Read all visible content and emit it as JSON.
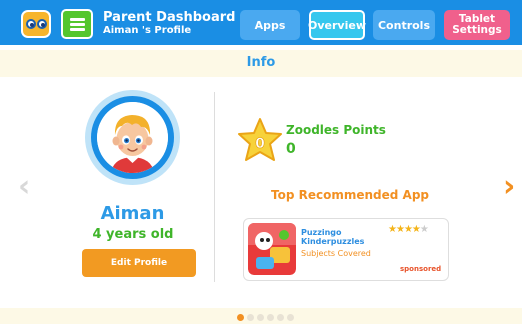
{
  "header": {
    "title": "Parent Dashboard",
    "subtitle": "Aiman 's Profile",
    "tabs": [
      {
        "label": "Apps"
      },
      {
        "label": "Overview"
      },
      {
        "label": "Controls"
      },
      {
        "label": "Tablet Settings"
      }
    ],
    "active_tab": "Overview"
  },
  "section": {
    "title": "Info"
  },
  "profile": {
    "name": "Aiman",
    "age": "4 years old",
    "edit_label": "Edit Profile"
  },
  "points": {
    "label": "Zoodles Points",
    "value": "0",
    "star_digit": "0"
  },
  "recommended": {
    "title": "Top Recommended App",
    "app": {
      "name_line1": "Puzzingo",
      "name_line2": "Kinderpuzzles",
      "subtitle": "Subjects Covered",
      "rating": 4,
      "rating_max": 5,
      "sponsored_label": "sponsored"
    }
  },
  "pager": {
    "total": 6,
    "active_index": 0
  },
  "icons": {
    "logo": "zoodles-logo-icon",
    "menu": "hamburger-menu-icon",
    "prev": "chevron-left-icon",
    "next": "chevron-right-icon",
    "star": "star-icon"
  },
  "colors": {
    "topbar": "#1a8ee4",
    "accent_orange": "#f29022",
    "green": "#3fb52a",
    "tablet_tab": "#f0608c",
    "overview_tab": "#36c7ee"
  }
}
